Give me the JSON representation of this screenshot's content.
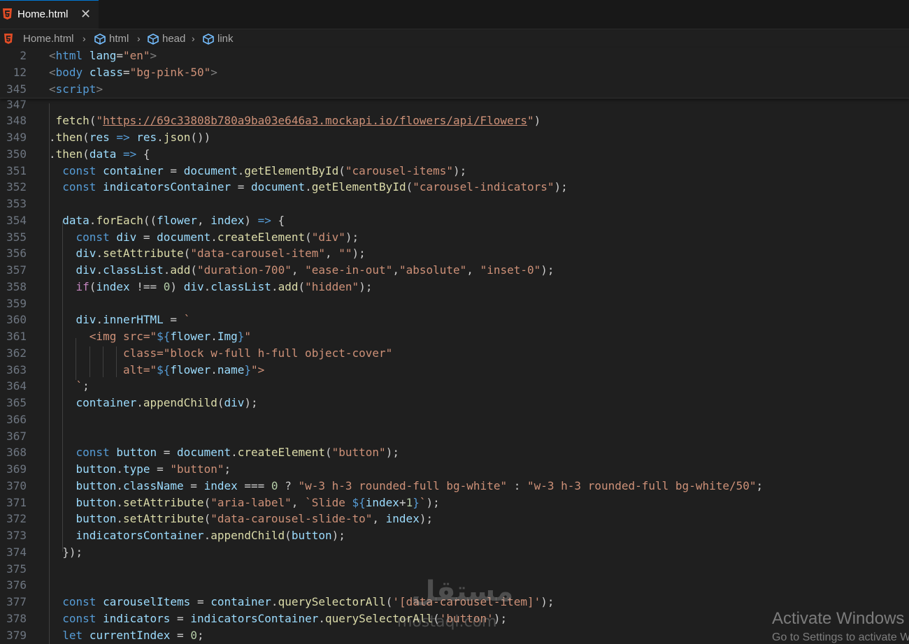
{
  "tab": {
    "file_name": "Home.html",
    "close": "✕"
  },
  "breadcrumb": [
    "Home.html",
    "html",
    "head",
    "link"
  ],
  "sticky_lines": [
    {
      "num": "2",
      "text": "<html lang=\"en\">"
    },
    {
      "num": "12",
      "text": "<body class=\"bg-pink-50\">"
    },
    {
      "num": "345",
      "text": "<script>"
    }
  ],
  "code_lines": [
    {
      "num": "347",
      "text": ""
    },
    {
      "num": "348",
      "text": " fetch(\"https://69c33808b780a9ba03e646a3.mockapi.io/flowers/api/Flowers\")"
    },
    {
      "num": "349",
      "text": ".then(res => res.json())"
    },
    {
      "num": "350",
      "text": ".then(data => {"
    },
    {
      "num": "351",
      "text": "  const container = document.getElementById(\"carousel-items\");"
    },
    {
      "num": "352",
      "text": "  const indicatorsContainer = document.getElementById(\"carousel-indicators\");"
    },
    {
      "num": "353",
      "text": ""
    },
    {
      "num": "354",
      "text": "  data.forEach((flower, index) => {"
    },
    {
      "num": "355",
      "text": "    const div = document.createElement(\"div\");"
    },
    {
      "num": "356",
      "text": "    div.setAttribute(\"data-carousel-item\", \"\");"
    },
    {
      "num": "357",
      "text": "    div.classList.add(\"duration-700\", \"ease-in-out\",\"absolute\", \"inset-0\");"
    },
    {
      "num": "358",
      "text": "    if(index !== 0) div.classList.add(\"hidden\");"
    },
    {
      "num": "359",
      "text": ""
    },
    {
      "num": "360",
      "text": "    div.innerHTML = `"
    },
    {
      "num": "361",
      "text": "      <img src=\"${flower.Img}\""
    },
    {
      "num": "362",
      "text": "           class=\"block w-full h-full object-cover\""
    },
    {
      "num": "363",
      "text": "           alt=\"${flower.name}\">"
    },
    {
      "num": "364",
      "text": "    `;"
    },
    {
      "num": "365",
      "text": "    container.appendChild(div);"
    },
    {
      "num": "366",
      "text": ""
    },
    {
      "num": "367",
      "text": ""
    },
    {
      "num": "368",
      "text": "    const button = document.createElement(\"button\");"
    },
    {
      "num": "369",
      "text": "    button.type = \"button\";"
    },
    {
      "num": "370",
      "text": "    button.className = index === 0 ? \"w-3 h-3 rounded-full bg-white\" : \"w-3 h-3 rounded-full bg-white/50\";"
    },
    {
      "num": "371",
      "text": "    button.setAttribute(\"aria-label\", `Slide ${index+1}`);"
    },
    {
      "num": "372",
      "text": "    button.setAttribute(\"data-carousel-slide-to\", index);"
    },
    {
      "num": "373",
      "text": "    indicatorsContainer.appendChild(button);"
    },
    {
      "num": "374",
      "text": "  });"
    },
    {
      "num": "375",
      "text": ""
    },
    {
      "num": "376",
      "text": ""
    },
    {
      "num": "377",
      "text": "  const carouselItems = container.querySelectorAll('[data-carousel-item]');"
    },
    {
      "num": "378",
      "text": "  const indicators = indicatorsContainer.querySelectorAll('button');"
    },
    {
      "num": "379",
      "text": "  let currentIndex = 0;"
    }
  ],
  "watermark": {
    "arabic": "مستقل",
    "latin": "mostaql.com"
  },
  "activate_windows": {
    "title": "Activate Windows",
    "subtitle": "Go to Settings to activate Windows."
  },
  "colors": {
    "accent": "#0078d4",
    "html_icon": "#e44d26",
    "background": "#1f1f1f"
  }
}
